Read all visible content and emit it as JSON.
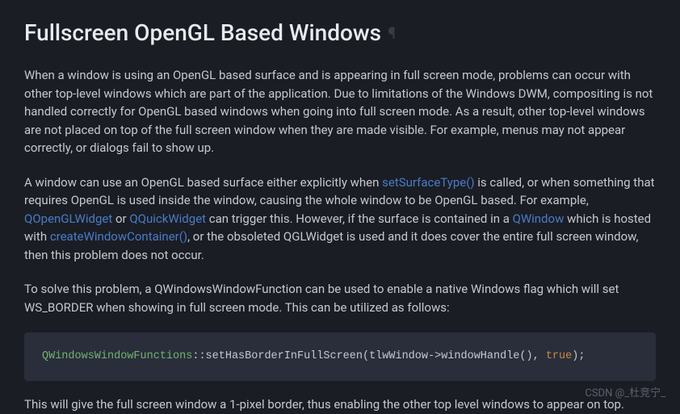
{
  "heading": "Fullscreen OpenGL Based Windows",
  "para1": "When a window is using an OpenGL based surface and is appearing in full screen mode, problems can occur with other top-level windows which are part of the application. Due to limitations of the Windows DWM, compositing is not handled correctly for OpenGL based windows when going into full screen mode. As a result, other top-level windows are not placed on top of the full screen window when they are made visible. For example, menus may not appear correctly, or dialogs fail to show up.",
  "para2": {
    "t1": "A window can use an OpenGL based surface either explicitly when ",
    "link_setSurfaceType": "setSurfaceType()",
    "t2": " is called, or when something that requires OpenGL is used inside the window, causing the whole window to be OpenGL based. For example, ",
    "link_QOpenGLWidget": "QOpenGLWidget",
    "t3": " or ",
    "link_QQuickWidget": "QQuickWidget",
    "t4": " can trigger this. However, if the surface is contained in a ",
    "link_QWindow": "QWindow",
    "t5": " which is hosted with ",
    "link_createWindowContainer": "createWindowContainer()",
    "t6": ", or the obsoleted QGLWidget is used and it does cover the entire full screen window, then this problem does not occur."
  },
  "para3": "To solve this problem, a QWindowsWindowFunction can be used to enable a native Windows flag which will set WS_BORDER when showing in full screen mode. This can be utilized as follows:",
  "code": {
    "type": "QWindowsWindowFunctions",
    "mid": "::setHasBorderInFullScreen(tlwWindow->windowHandle(), ",
    "keyword": "true",
    "end": ");"
  },
  "para4": "This will give the full screen window a 1-pixel border, thus enabling the other top level windows to appear on top.",
  "watermark": "CSDN @_杜竞宁_"
}
